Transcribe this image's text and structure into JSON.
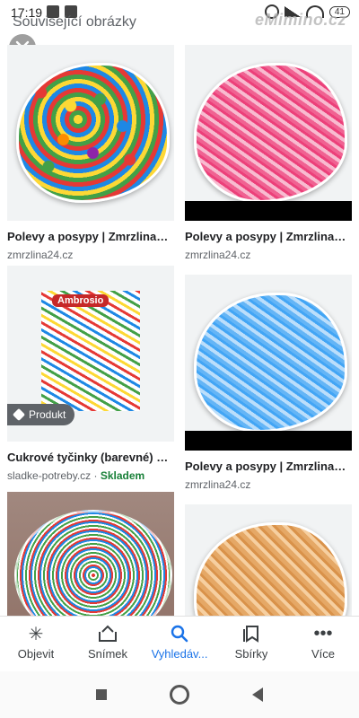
{
  "status_bar": {
    "time": "17:19",
    "battery": "41"
  },
  "watermark": "eMimino.cz",
  "section_title": "Související obrázky",
  "results": [
    {
      "title": "Polevy a posypy | Zmrzlina24....",
      "source": "zmrzlina24.cz"
    },
    {
      "title": "Polevy a posypy | Zmrzlina24....",
      "source": "zmrzlina24.cz"
    },
    {
      "title": "Cukrové tyčinky (barevné) 1 k...",
      "source": "sladke-potreby.cz",
      "separator": " · ",
      "stock": "Skladem",
      "badge": "Produkt",
      "brand": "Ambrosio"
    },
    {
      "title": "Polevy a posypy | Zmrzlina24....",
      "source": "zmrzlina24.cz"
    },
    {
      "title": "",
      "source": ""
    },
    {
      "title": "",
      "source": ""
    }
  ],
  "bottom_nav": [
    {
      "label": "Objevit",
      "icon": "asterisk-icon"
    },
    {
      "label": "Snímek",
      "icon": "snapshot-icon"
    },
    {
      "label": "Vyhledáv...",
      "icon": "search-icon"
    },
    {
      "label": "Sbírky",
      "icon": "collections-icon"
    },
    {
      "label": "Více",
      "icon": "more-icon"
    }
  ],
  "colors": {
    "accent": "#1a73e8",
    "stock": "#188038",
    "badge": "#5f6368"
  }
}
